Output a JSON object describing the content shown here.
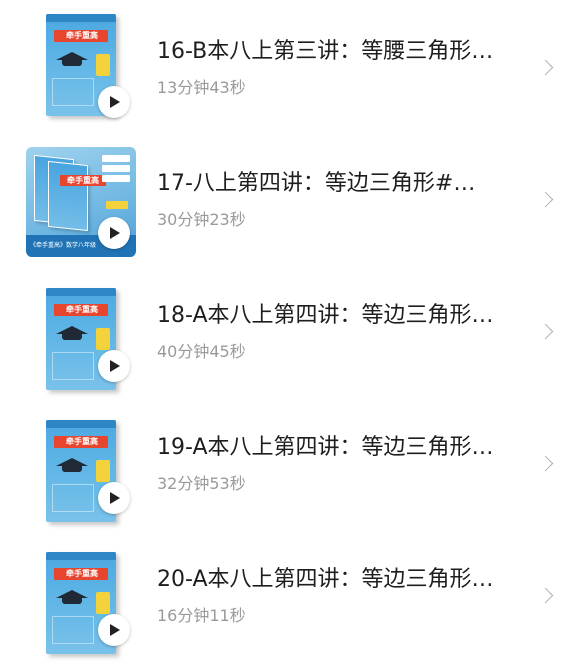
{
  "lessons": [
    {
      "title": "16-B本八上第三讲：等腰三角形…",
      "duration": "13分钟43秒",
      "cover_title": "牵手重高",
      "cover": "single-book"
    },
    {
      "title": "17-八上第四讲：等边三角形#…",
      "duration": "30分钟23秒",
      "cover_title": "牵手重高",
      "cover": "promo-books",
      "cover_banner": "《牵手重高》数学八年级"
    },
    {
      "title": "18-A本八上第四讲：等边三角形…",
      "duration": "40分钟45秒",
      "cover_title": "牵手重高",
      "cover": "single-book"
    },
    {
      "title": "19-A本八上第四讲：等边三角形…",
      "duration": "32分钟53秒",
      "cover_title": "牵手重高",
      "cover": "single-book"
    },
    {
      "title": "20-A本八上第四讲：等边三角形…",
      "duration": "16分钟11秒",
      "cover_title": "牵手重高",
      "cover": "single-book"
    }
  ],
  "icons": {
    "play": "play-icon",
    "chevron": "chevron-right-icon"
  },
  "colors": {
    "title_text": "#1e1e1e",
    "duration_text": "#9a9a9a",
    "cover_blue": "#4aa8e0",
    "cover_red": "#e8452f",
    "chevron": "#b0b0b0"
  }
}
